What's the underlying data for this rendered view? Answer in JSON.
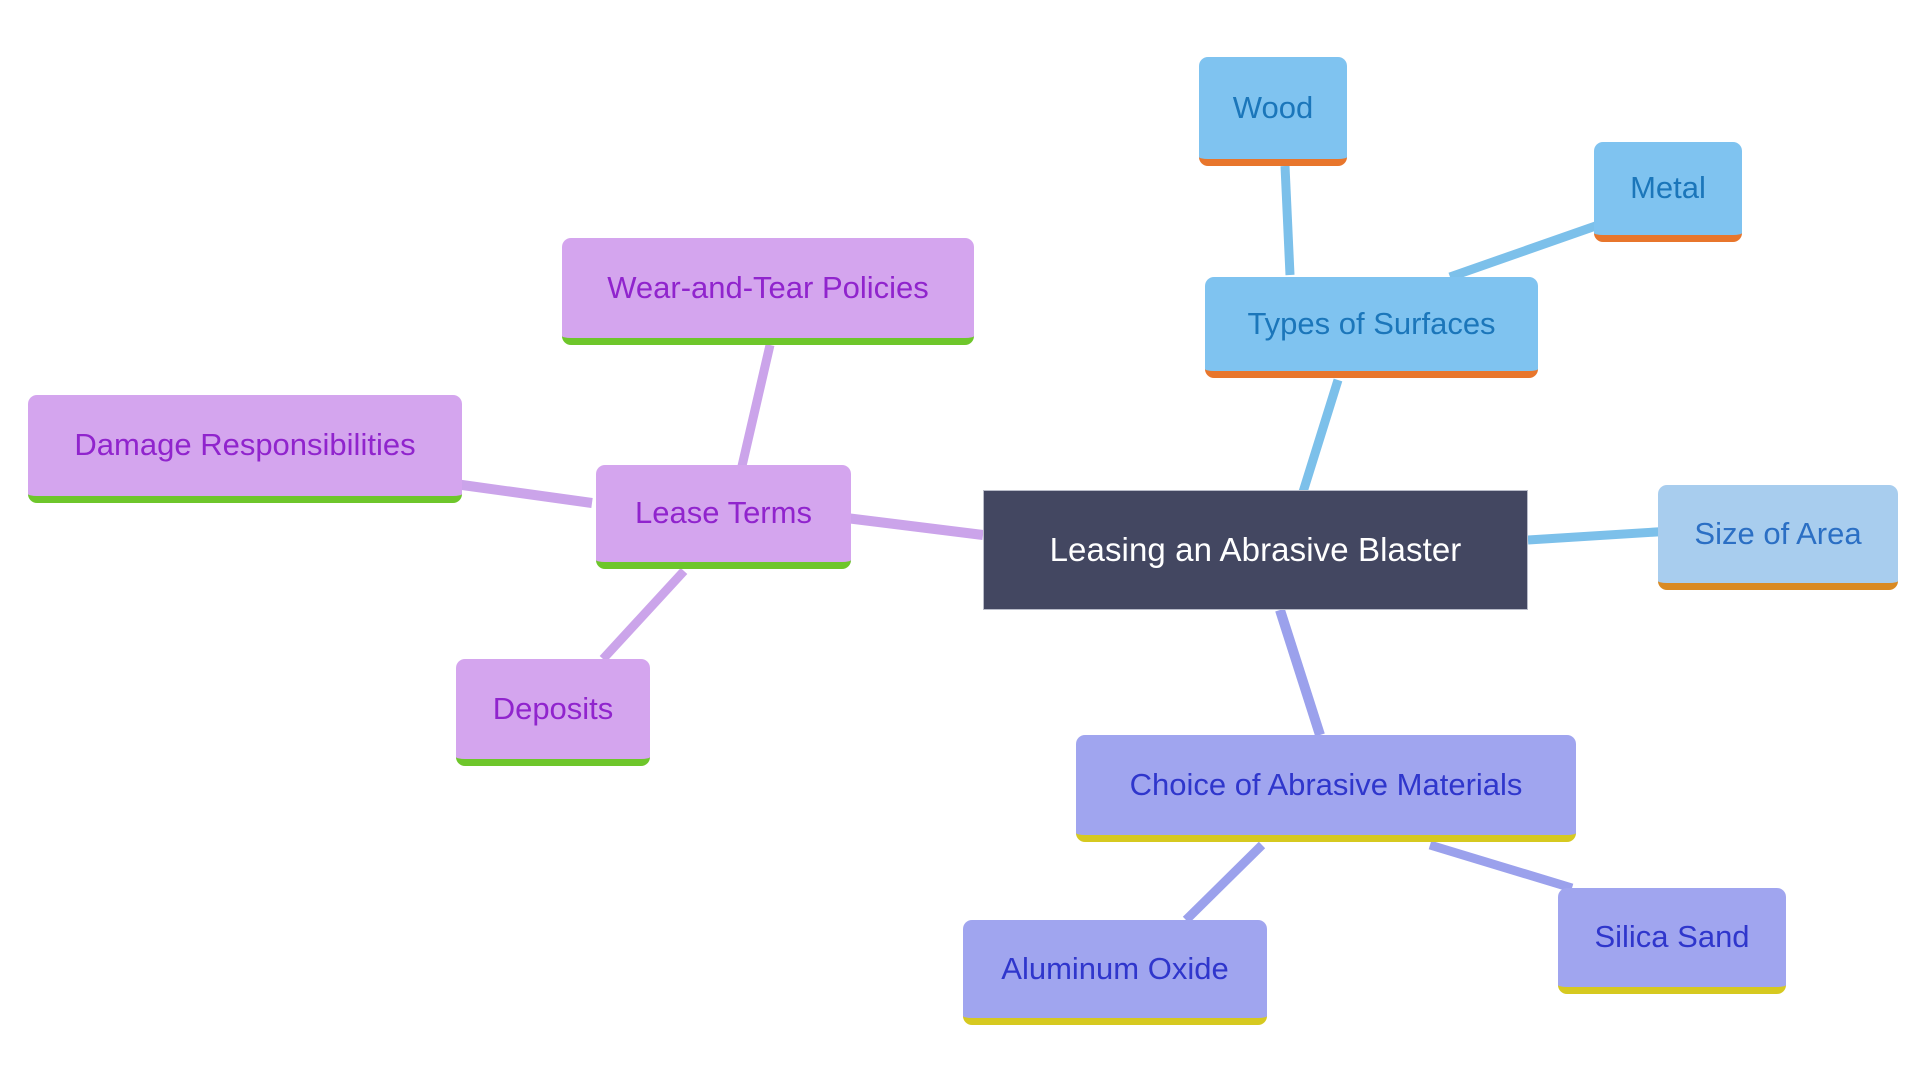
{
  "diagram": {
    "type": "mind-map",
    "title": "Leasing an Abrasive Blaster",
    "background": "#ffffff",
    "root": {
      "id": "root",
      "label": "Leasing an Abrasive Blaster",
      "fill": "#434761",
      "text_color": "#ffffff"
    },
    "branches": [
      {
        "id": "types-of-surfaces",
        "label": "Types of Surfaces",
        "fill": "#7fc3f0",
        "text_color": "#1b76ba",
        "accent": "#e8762c",
        "edge_color": "#7cc0ea",
        "children": [
          {
            "id": "wood",
            "label": "Wood",
            "fill": "#7fc3f0",
            "text_color": "#1b76ba",
            "accent": "#e8762c"
          },
          {
            "id": "metal",
            "label": "Metal",
            "fill": "#7fc3f0",
            "text_color": "#1b76ba",
            "accent": "#e8762c"
          }
        ]
      },
      {
        "id": "size-of-area",
        "label": "Size of Area",
        "fill": "#a8cdee",
        "text_color": "#2b6fc4",
        "accent": "#d98a23",
        "edge_color": "#7cc0ea",
        "children": []
      },
      {
        "id": "lease-terms",
        "label": "Lease Terms",
        "fill": "#d4a5ee",
        "text_color": "#9024cd",
        "accent": "#6ec62b",
        "edge_color": "#cba4ea",
        "children": [
          {
            "id": "wear-and-tear-policies",
            "label": "Wear-and-Tear Policies",
            "fill": "#d4a5ee",
            "text_color": "#9024cd",
            "accent": "#6ec62b"
          },
          {
            "id": "damage-responsibilities",
            "label": "Damage Responsibilities",
            "fill": "#d4a5ee",
            "text_color": "#9024cd",
            "accent": "#6ec62b"
          },
          {
            "id": "deposits",
            "label": "Deposits",
            "fill": "#d4a5ee",
            "text_color": "#9024cd",
            "accent": "#6ec62b"
          }
        ]
      },
      {
        "id": "choice-of-abrasive-materials",
        "label": "Choice of Abrasive Materials",
        "fill": "#a0a5ef",
        "text_color": "#2f36cc",
        "accent": "#d6c920",
        "edge_color": "#9ba1ec",
        "children": [
          {
            "id": "aluminum-oxide",
            "label": "Aluminum Oxide",
            "fill": "#a0a5ef",
            "text_color": "#2f36cc",
            "accent": "#d6c920"
          },
          {
            "id": "silica-sand",
            "label": "Silica Sand",
            "fill": "#a0a5ef",
            "text_color": "#2f36cc",
            "accent": "#d6c920"
          }
        ]
      }
    ]
  }
}
